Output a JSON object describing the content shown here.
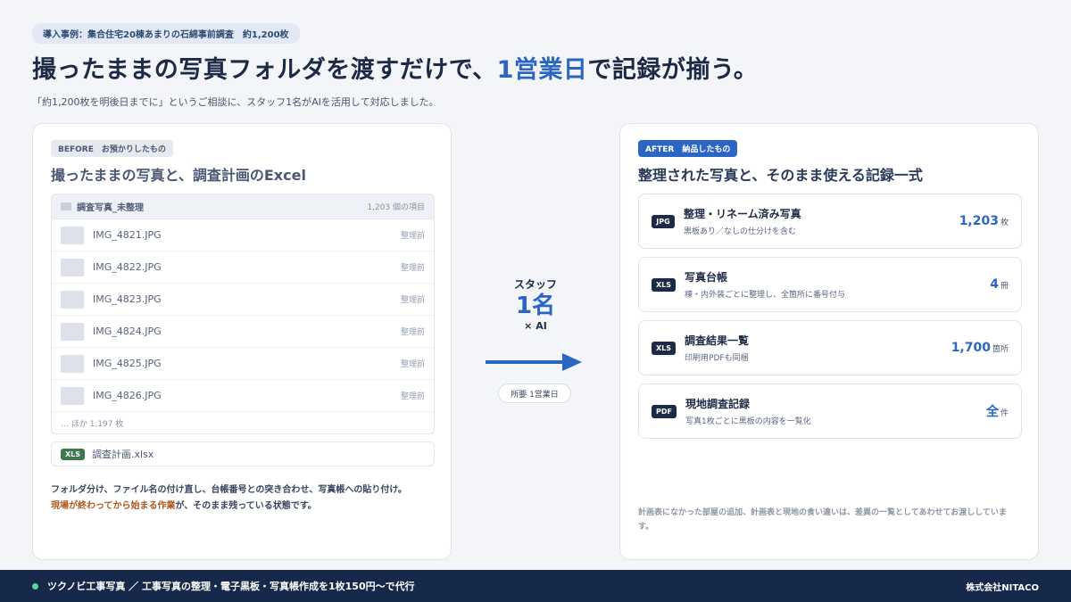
{
  "top_tag": "導入事例：集合住宅20棟あまりの石綿事前調査　約1,200枚",
  "headline": {
    "prefix": "撮ったままの写真フォルダを渡すだけで、",
    "highlight": "1営業日",
    "suffix": "で記録が揃う。"
  },
  "lead": "「約1,200枚を明後日までに」というご相談に、スタッフ1名がAIを活用して対応しました。",
  "before": {
    "tag": "BEFORE　お預かりしたもの",
    "title": "撮ったままの写真と、調査計画のExcel",
    "folder_name": "調査写真_未整理",
    "folder_count": "1,203 個の項目",
    "files": [
      {
        "name": "IMG_4821.JPG",
        "status": "整理前"
      },
      {
        "name": "IMG_4822.JPG",
        "status": "整理前"
      },
      {
        "name": "IMG_4823.JPG",
        "status": "整理前"
      },
      {
        "name": "IMG_4824.JPG",
        "status": "整理前"
      },
      {
        "name": "IMG_4825.JPG",
        "status": "整理前"
      },
      {
        "name": "IMG_4826.JPG",
        "status": "整理前"
      }
    ],
    "more": "… ほか 1,197 枚",
    "xls_badge": "XLS",
    "xls_name": "調査計画.xlsx",
    "note_line1": "フォルダ分け、ファイル名の付け直し、台帳番号との突き合わせ、写真帳への貼り付け。",
    "note_warn": "現場が終わってから始まる作業",
    "note_rest": "が、そのまま残っている状態です。"
  },
  "middle": {
    "staff": "スタッフ",
    "count": "1名",
    "ai": "× AI",
    "duration": "所要 1営業日"
  },
  "after": {
    "tag": "AFTER　納品したもの",
    "title": "整理された写真と、そのまま使える記録一式",
    "items": [
      {
        "type": "JPG",
        "name": "整理・リネーム済み写真",
        "desc": "黒板あり／なしの仕分けを含む",
        "value": "1,203",
        "unit": "枚"
      },
      {
        "type": "XLS",
        "name": "写真台帳",
        "desc": "棟・内外装ごとに整理し、全箇所に番号付与",
        "value": "4",
        "unit": "冊"
      },
      {
        "type": "XLS",
        "name": "調査結果一覧",
        "desc": "印刷用PDFも同梱",
        "value": "1,700",
        "unit": "箇所"
      },
      {
        "type": "PDF",
        "name": "現地調査記録",
        "desc": "写真1枚ごとに黒板の内容を一覧化",
        "value": "全",
        "unit": "件"
      }
    ],
    "note": "計画表になかった部屋の追加、計画表と現地の食い違いは、差異の一覧としてあわせてお渡ししています。"
  },
  "footer": {
    "service": "ツクノビ工事写真 ／ 工事写真の整理・電子黒板・写真帳作成を1枚150円〜で代行",
    "company": "株式会社NITACO"
  },
  "colors": {
    "accent": "#2b66c4",
    "navy": "#16294a",
    "warn": "#b0581a",
    "xls_green": "#3c7a4e"
  }
}
